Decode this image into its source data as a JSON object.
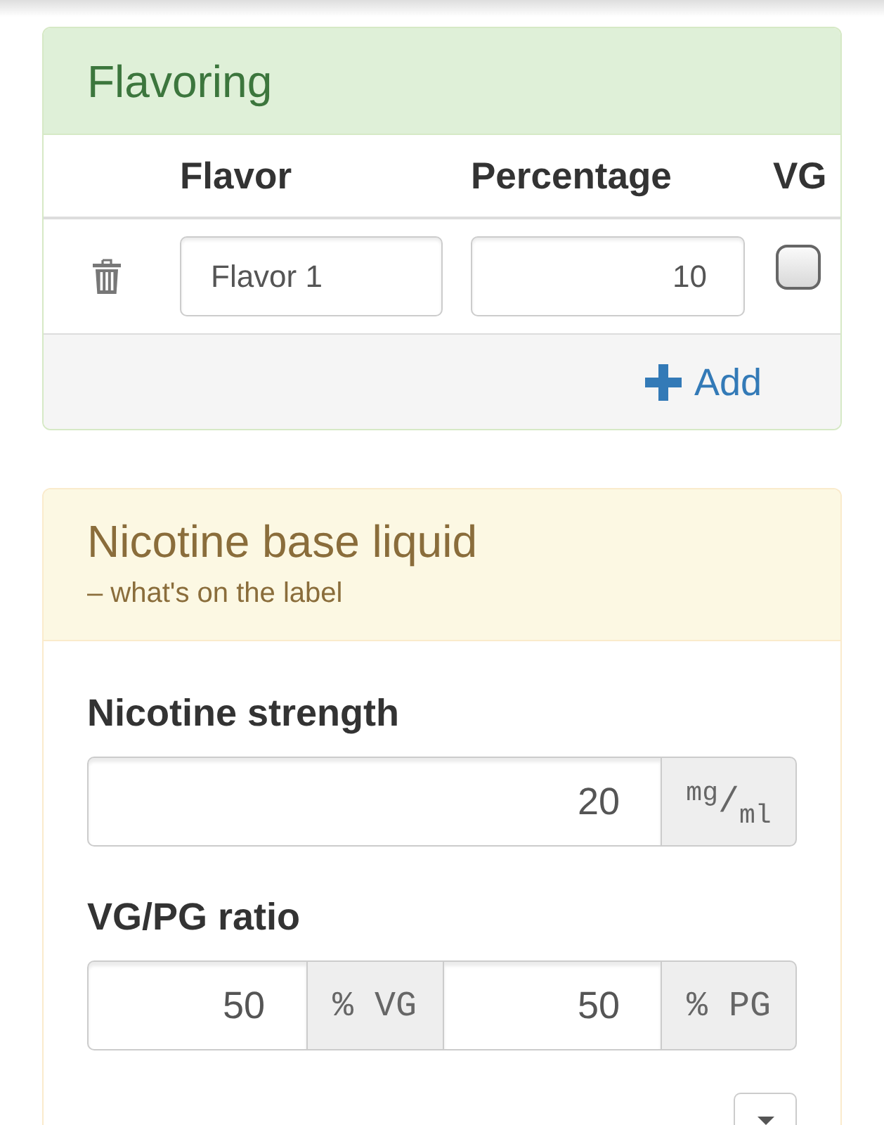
{
  "flavoring": {
    "title": "Flavoring",
    "columns": [
      "Flavor",
      "Percentage",
      "VG"
    ],
    "rows": [
      {
        "flavor": "Flavor 1",
        "percentage": "10",
        "vg": false
      }
    ],
    "add_button": "Add"
  },
  "nicotine_base": {
    "title": "Nicotine base liquid",
    "subtitle": "– what's on the label",
    "fields": [
      {
        "label": "Nicotine strength",
        "inputs": [
          {
            "value": "20",
            "unit": "$^{mg}$/$_{ml}$"
          }
        ]
      },
      {
        "label": "VG/PG ratio",
        "inputs": [
          {
            "value": "50",
            "unit": "% VG"
          },
          {
            "value": "50",
            "unit": "% PG"
          }
        ]
      }
    ]
  }
}
